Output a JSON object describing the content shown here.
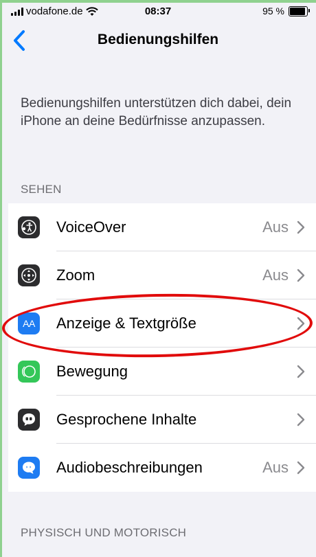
{
  "status_bar": {
    "carrier": "vodafone.de",
    "time": "08:37",
    "battery": "95 %"
  },
  "nav": {
    "title": "Bedienungshilfen"
  },
  "description": "Bedienungshilfen unterstützen dich dabei, dein iPhone an deine Bedürfnisse anzupassen.",
  "sections": {
    "sehen": "SEHEN",
    "physisch": "PHYSISCH UND MOTORISCH"
  },
  "rows": [
    {
      "label": "VoiceOver",
      "value": "Aus",
      "icon": "voiceover-icon",
      "color": "#2c2c2e"
    },
    {
      "label": "Zoom",
      "value": "Aus",
      "icon": "zoom-icon",
      "color": "#2c2c2e"
    },
    {
      "label": "Anzeige & Textgröße",
      "value": "",
      "icon": "text-size-icon",
      "color": "#1e7cf2",
      "icon_text": "AA"
    },
    {
      "label": "Bewegung",
      "value": "",
      "icon": "motion-icon",
      "color": "#34c759"
    },
    {
      "label": "Gesprochene Inhalte",
      "value": "",
      "icon": "spoken-content-icon",
      "color": "#2c2c2e"
    },
    {
      "label": "Audiobeschreibungen",
      "value": "Aus",
      "icon": "audio-descriptions-icon",
      "color": "#1e7cf2"
    }
  ],
  "highlight_color": "#e10b0b"
}
